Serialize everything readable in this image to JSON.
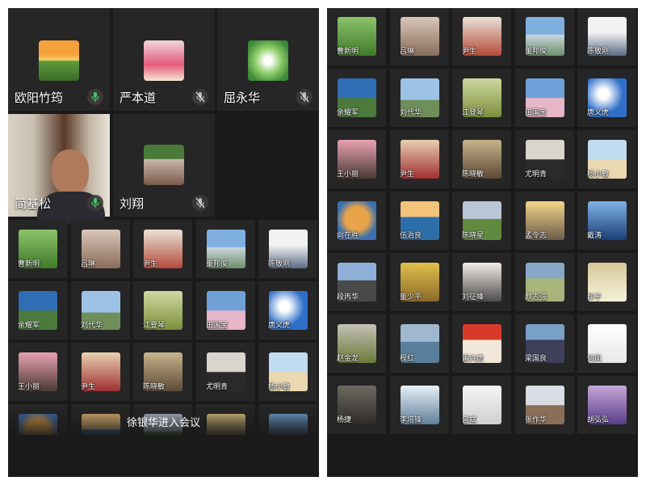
{
  "left": {
    "featured": [
      {
        "name": "欧阳竹筠",
        "mic": "on"
      },
      {
        "name": "严本道",
        "mic": "muted"
      },
      {
        "name": "屈永华",
        "mic": "muted"
      },
      {
        "name": "简基松",
        "mic": "on"
      },
      {
        "name": "刘翔",
        "mic": "muted"
      }
    ],
    "grid": [
      "曹新明",
      "吕琳",
      "尹生",
      "董邦俊",
      "陈敬刚",
      "余耀军",
      "刘代华",
      "江登琴",
      "田国宝",
      "唐义虎",
      "王小丽",
      "尹生",
      "陈晓敏",
      "尤明青",
      "杨小敏"
    ],
    "toast": "徐银华进入会议"
  },
  "right": {
    "grid": [
      "曹新明",
      "吕琳",
      "尹生",
      "董邦俊",
      "陈敬刚",
      "余耀军",
      "刘代华",
      "江登琴",
      "田国宝",
      "唐义虎",
      "王小丽",
      "尹生",
      "陈晓敏",
      "尤明青",
      "杨小敏",
      "向在胜",
      "伍治良",
      "陈晓星",
      "孟令志",
      "戴涛",
      "段丙华",
      "董少平",
      "刘征峰",
      "颜志强",
      "印子",
      "赵金龙",
      "程红",
      "雷兴虎",
      "梁国良",
      "何凤",
      "杨捷",
      "李培锋",
      "曾斌",
      "张作华",
      "胡弘弘"
    ]
  }
}
